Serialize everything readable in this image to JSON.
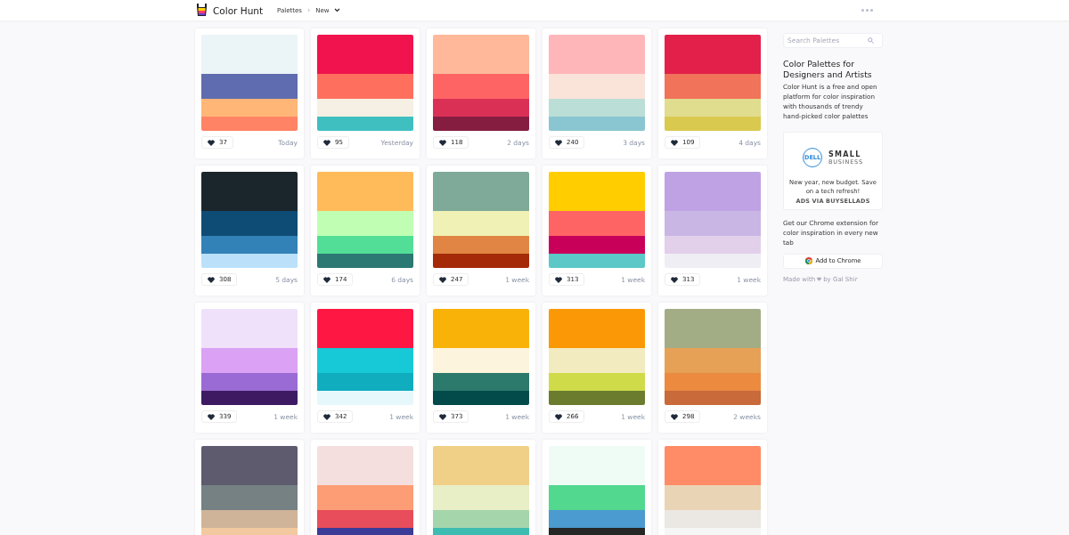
{
  "header": {
    "brand": "Color Hunt",
    "breadcrumb": [
      "Palettes",
      "New"
    ],
    "separator": "›"
  },
  "palettes": [
    {
      "swatches": [
        {
          "color": "#ebf4f6"
        },
        {
          "color": "#5f6caf"
        },
        {
          "color": "#ffb677"
        },
        {
          "color": "#ff8364"
        }
      ],
      "likes": "37",
      "time": "Today"
    },
    {
      "swatches": [
        {
          "color": "#f0134d"
        },
        {
          "color": "#ff6f5e"
        },
        {
          "color": "#f5f0e3"
        },
        {
          "color": "#40bfc1"
        }
      ],
      "likes": "95",
      "time": "Yesterday"
    },
    {
      "swatches": [
        {
          "color": "#ffb99a"
        },
        {
          "color": "#ff6464"
        },
        {
          "color": "#db3056"
        },
        {
          "color": "#851d41"
        }
      ],
      "likes": "118",
      "time": "2 days"
    },
    {
      "swatches": [
        {
          "color": "#ffb6b9"
        },
        {
          "color": "#fae3d9"
        },
        {
          "color": "#bbded6"
        },
        {
          "color": "#8ac6d1"
        }
      ],
      "likes": "240",
      "time": "3 days"
    },
    {
      "swatches": [
        {
          "color": "#e3204a"
        },
        {
          "color": "#f0735a"
        },
        {
          "color": "#e1dd8f"
        },
        {
          "color": "#d9c94f"
        }
      ],
      "likes": "109",
      "time": "4 days"
    },
    {
      "swatches": [
        {
          "color": "#1b262c"
        },
        {
          "color": "#0f4c75"
        },
        {
          "color": "#3282b8"
        },
        {
          "color": "#bbe1fa"
        }
      ],
      "likes": "308",
      "time": "5 days"
    },
    {
      "swatches": [
        {
          "color": "#ffba5a"
        },
        {
          "color": "#c0ffb3"
        },
        {
          "color": "#52de97"
        },
        {
          "color": "#2c7873"
        }
      ],
      "likes": "174",
      "time": "6 days"
    },
    {
      "swatches": [
        {
          "color": "#7fa998"
        },
        {
          "color": "#f0f1b4"
        },
        {
          "color": "#e08543"
        },
        {
          "color": "#a52a07"
        }
      ],
      "likes": "247",
      "time": "1 week"
    },
    {
      "swatches": [
        {
          "color": "#ffcd00"
        },
        {
          "color": "#ff6464"
        },
        {
          "color": "#c8005a"
        },
        {
          "color": "#5cc8c8"
        }
      ],
      "likes": "313",
      "time": "1 week"
    },
    {
      "swatches": [
        {
          "color": "#bfa2e3"
        },
        {
          "color": "#c9b6e4"
        },
        {
          "color": "#e2cfea"
        },
        {
          "color": "#f0eef5"
        }
      ],
      "likes": "313",
      "time": "1 week"
    },
    {
      "swatches": [
        {
          "color": "#f0e1fb"
        },
        {
          "color": "#dba1f4"
        },
        {
          "color": "#9a6bd4"
        },
        {
          "color": "#3e1a63"
        }
      ],
      "likes": "339",
      "time": "1 week"
    },
    {
      "swatches": [
        {
          "color": "#ff1744"
        },
        {
          "color": "#17c9d6"
        },
        {
          "color": "#10adbf"
        },
        {
          "color": "#e6f8fb"
        }
      ],
      "likes": "342",
      "time": "1 week"
    },
    {
      "swatches": [
        {
          "color": "#f9b208"
        },
        {
          "color": "#fcf4dc"
        },
        {
          "color": "#2c7a6c"
        },
        {
          "color": "#024b4a"
        }
      ],
      "likes": "373",
      "time": "1 week"
    },
    {
      "swatches": [
        {
          "color": "#fa9905"
        },
        {
          "color": "#f3ebc0"
        },
        {
          "color": "#cfdb49"
        },
        {
          "color": "#6b7c2f"
        }
      ],
      "likes": "266",
      "time": "1 week"
    },
    {
      "swatches": [
        {
          "color": "#a2ad86"
        },
        {
          "color": "#e6a157"
        },
        {
          "color": "#ec8a40"
        },
        {
          "color": "#c86a3a"
        }
      ],
      "likes": "298",
      "time": "2 weeks"
    },
    {
      "swatches": [
        {
          "color": "#5e5b6e"
        },
        {
          "color": "#758183"
        },
        {
          "color": "#cfb499"
        },
        {
          "color": "#f3c9a0"
        }
      ]
    },
    {
      "swatches": [
        {
          "color": "#f5dede"
        },
        {
          "color": "#fc9d75"
        },
        {
          "color": "#e84d5b"
        },
        {
          "color": "#3b3b98"
        }
      ]
    },
    {
      "swatches": [
        {
          "color": "#f0cf87"
        },
        {
          "color": "#e8eec5"
        },
        {
          "color": "#a4d5ab"
        },
        {
          "color": "#3dbdb1"
        }
      ]
    },
    {
      "swatches": [
        {
          "color": "#effcf6"
        },
        {
          "color": "#52d88f"
        },
        {
          "color": "#4b9ad0"
        },
        {
          "color": "#262626"
        }
      ]
    },
    {
      "swatches": [
        {
          "color": "#ff8c66"
        },
        {
          "color": "#e9d5b5"
        },
        {
          "color": "#ebe7e3"
        },
        {
          "color": "#f6f6f6"
        }
      ]
    }
  ],
  "sidebar": {
    "search": {
      "placeholder": "Search Palettes"
    },
    "title": "Color Palettes for Designers and Artists",
    "description": "Color Hunt is a free and open platform for color inspiration with thousands of trendy hand-picked color palettes",
    "ad": {
      "logo": "DELL",
      "brand_line_1": "SMALL",
      "brand_line_2": "BUSINESS",
      "text": "New year, new budget. Save on a tech refresh!",
      "via": "ADS VIA BUYSELLADS"
    },
    "extension_text": "Get our Chrome extension for color inspiration in every new tab",
    "extension_button": "Add to Chrome",
    "credit_before": "Made with",
    "credit_after": "by Gal Shir"
  }
}
